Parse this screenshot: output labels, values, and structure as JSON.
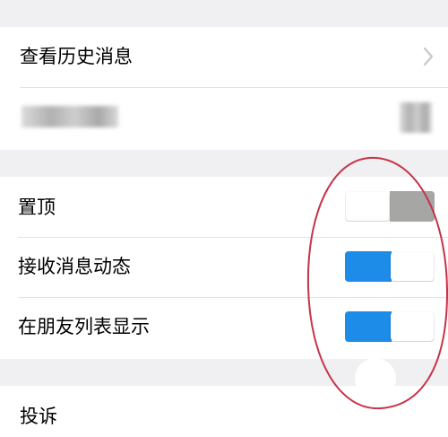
{
  "rows": {
    "history": {
      "label": "查看历史消息"
    },
    "pin": {
      "label": "置顶",
      "on": false
    },
    "receive": {
      "label": "接收消息动态",
      "on": true
    },
    "friends": {
      "label": "在朋友列表显示",
      "on": true
    },
    "report": {
      "label": "投诉"
    }
  },
  "colors": {
    "switch_on": "#1d8ce8",
    "switch_off": "#a6a7a5",
    "annotation": "#c6334a",
    "background": "#f0f0f2"
  },
  "icons": {
    "disclosure": "chevron-right-icon"
  }
}
